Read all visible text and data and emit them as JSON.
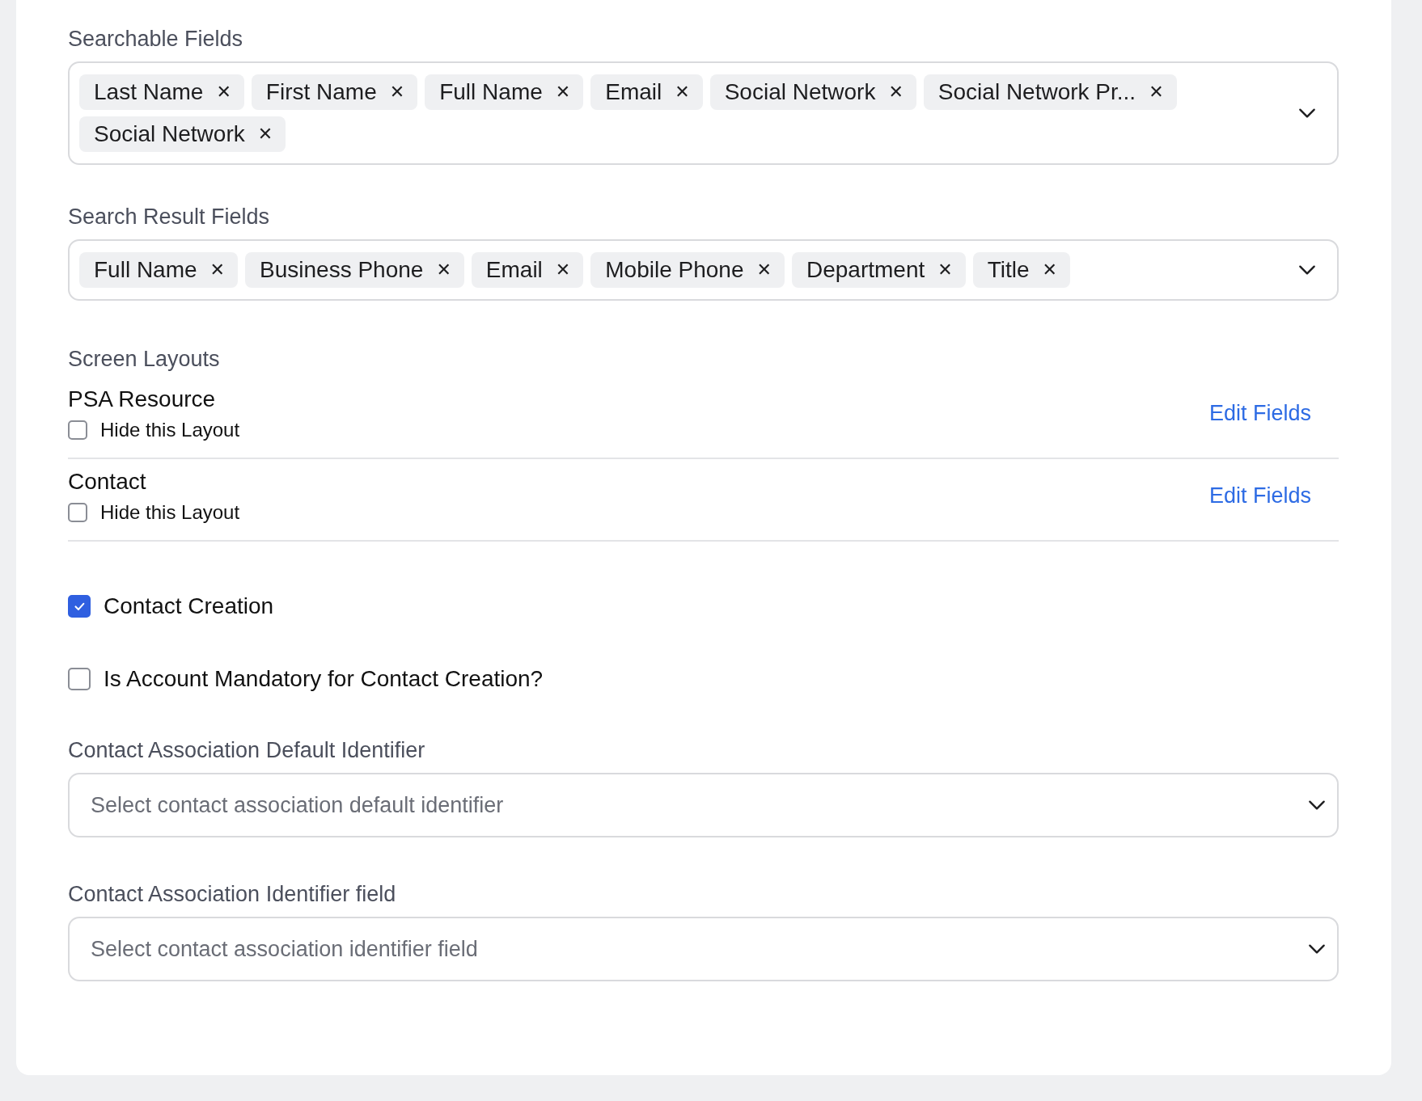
{
  "searchable_fields": {
    "label": "Searchable Fields",
    "chips": [
      {
        "label": "Last Name",
        "remove": "✕"
      },
      {
        "label": "First Name",
        "remove": "✕"
      },
      {
        "label": "Full Name",
        "remove": "✕"
      },
      {
        "label": "Email",
        "remove": "✕"
      },
      {
        "label": "Social Network",
        "remove": "✕"
      },
      {
        "label": "Social Network Pr...",
        "remove": "✕"
      },
      {
        "label": "Social Network",
        "remove": "✕"
      }
    ]
  },
  "search_result_fields": {
    "label": "Search Result Fields",
    "chips": [
      {
        "label": "Full Name",
        "remove": "✕"
      },
      {
        "label": "Business Phone",
        "remove": "✕"
      },
      {
        "label": "Email",
        "remove": "✕"
      },
      {
        "label": "Mobile Phone",
        "remove": "✕"
      },
      {
        "label": "Department",
        "remove": "✕"
      },
      {
        "label": "Title",
        "remove": "✕"
      }
    ]
  },
  "screen_layouts": {
    "label": "Screen Layouts",
    "items": [
      {
        "name": "PSA Resource",
        "hide_label": "Hide this Layout",
        "checked": false,
        "link": "Edit Fields"
      },
      {
        "name": "Contact",
        "hide_label": "Hide this Layout",
        "checked": false,
        "link": "Edit Fields"
      }
    ]
  },
  "options": [
    {
      "label": "Contact Creation",
      "checked": true
    },
    {
      "label": "Is Account Mandatory for Contact Creation?",
      "checked": false
    }
  ],
  "selects": [
    {
      "label": "Contact Association Default Identifier",
      "placeholder": "Select contact association default identifier"
    },
    {
      "label": "Contact Association Identifier field",
      "placeholder": "Select contact association identifier field"
    }
  ]
}
